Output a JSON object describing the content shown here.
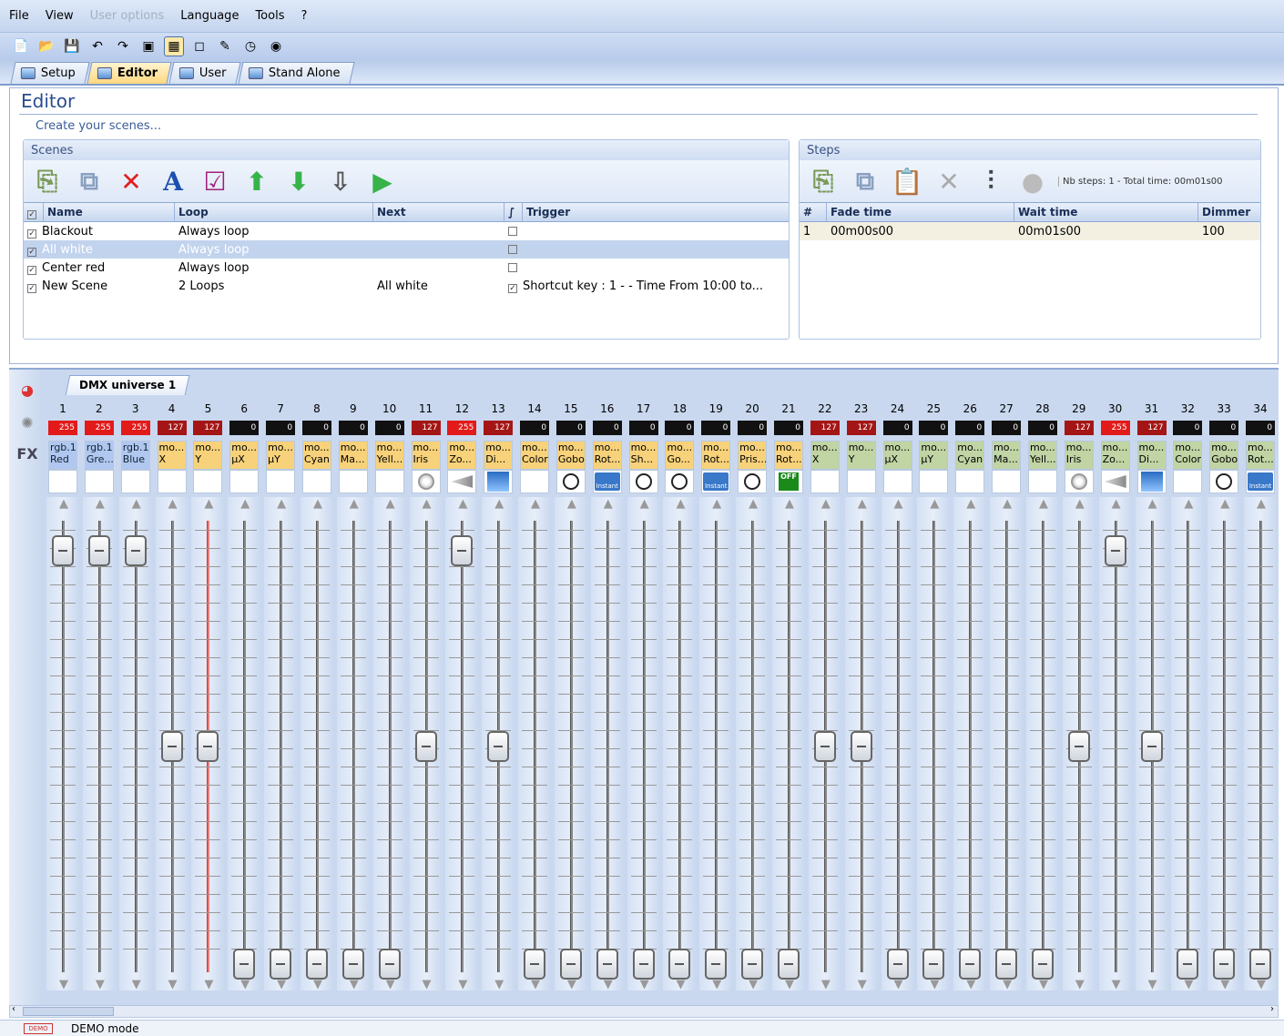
{
  "menu": {
    "file": "File",
    "view": "View",
    "user_options": "User options",
    "language": "Language",
    "tools": "Tools",
    "help": "?"
  },
  "tabs": [
    {
      "label": "Setup"
    },
    {
      "label": "Editor"
    },
    {
      "label": "User"
    },
    {
      "label": "Stand Alone"
    }
  ],
  "editor": {
    "title": "Editor",
    "subtitle": "Create your scenes..."
  },
  "scenes": {
    "header": "Scenes",
    "columns": [
      "Name",
      "Loop",
      "Next",
      "Trigger"
    ],
    "rows": [
      {
        "name": "Blackout",
        "loop": "Always loop",
        "next": "",
        "trigger": ""
      },
      {
        "name": "All white",
        "loop": "Always loop",
        "next": "",
        "trigger": ""
      },
      {
        "name": "Center red",
        "loop": "Always loop",
        "next": "",
        "trigger": ""
      },
      {
        "name": "New Scene",
        "loop": "2 Loops",
        "next": "All white",
        "trigger": "Shortcut key : 1 - - Time From 10:00  to..."
      }
    ]
  },
  "steps": {
    "header": "Steps",
    "summary": "Nb steps: 1 - Total time: 00m01s00",
    "columns": [
      "#",
      "Fade time",
      "Wait time",
      "Dimmer"
    ],
    "rows": [
      {
        "num": "1",
        "fade": "00m00s00",
        "wait": "00m01s00",
        "dimmer": "100"
      }
    ]
  },
  "universe": {
    "tab": "DMX universe 1"
  },
  "status": {
    "badge": "DEMO",
    "text": "DEMO mode"
  },
  "colors": {
    "accent": "#2a4d8f",
    "value_red": "#e31a1a",
    "value_dark": "#a41616",
    "channel_blue": "#b0c7f0",
    "channel_orange": "#f7d27a",
    "channel_green": "#c0d4a4"
  },
  "channels": [
    {
      "n": "1",
      "v": "255",
      "vc": "red",
      "label": "rgb.1\nRed",
      "c": "b",
      "icon": "",
      "lvl": 0.95
    },
    {
      "n": "2",
      "v": "255",
      "vc": "red",
      "label": "rgb.1\nGre...",
      "c": "b",
      "icon": "",
      "lvl": 0.95
    },
    {
      "n": "3",
      "v": "255",
      "vc": "red",
      "label": "rgb.1\nBlue",
      "c": "b",
      "icon": "",
      "lvl": 0.95
    },
    {
      "n": "4",
      "v": "127",
      "vc": "dred",
      "label": "mo...\nX",
      "c": "o",
      "icon": "",
      "lvl": 0.5
    },
    {
      "n": "5",
      "v": "127",
      "vc": "dred",
      "label": "mo...\nY",
      "c": "o",
      "icon": "",
      "lvl": 0.5,
      "redrail": true
    },
    {
      "n": "6",
      "v": "0",
      "vc": "blk",
      "label": "mo...\nµX",
      "c": "o",
      "icon": "",
      "lvl": 0
    },
    {
      "n": "7",
      "v": "0",
      "vc": "blk",
      "label": "mo...\nµY",
      "c": "o",
      "icon": "",
      "lvl": 0
    },
    {
      "n": "8",
      "v": "0",
      "vc": "blk",
      "label": "mo...\nCyan",
      "c": "o",
      "icon": "",
      "lvl": 0
    },
    {
      "n": "9",
      "v": "0",
      "vc": "blk",
      "label": "mo...\nMa...",
      "c": "o",
      "icon": "",
      "lvl": 0
    },
    {
      "n": "10",
      "v": "0",
      "vc": "blk",
      "label": "mo...\nYell...",
      "c": "o",
      "icon": "",
      "lvl": 0
    },
    {
      "n": "11",
      "v": "127",
      "vc": "dred",
      "label": "mo...\nIris",
      "c": "o",
      "icon": "iris",
      "lvl": 0.5
    },
    {
      "n": "12",
      "v": "255",
      "vc": "red",
      "label": "mo...\nZo...",
      "c": "o",
      "icon": "zoom",
      "lvl": 0.95
    },
    {
      "n": "13",
      "v": "127",
      "vc": "dred",
      "label": "mo...\nDi...",
      "c": "o",
      "icon": "dimm",
      "lvl": 0.5
    },
    {
      "n": "14",
      "v": "0",
      "vc": "blk",
      "label": "mo...\nColor",
      "c": "o",
      "icon": "",
      "lvl": 0
    },
    {
      "n": "15",
      "v": "0",
      "vc": "blk",
      "label": "mo...\nGobo",
      "c": "o",
      "icon": "gobo",
      "lvl": 0
    },
    {
      "n": "16",
      "v": "0",
      "vc": "blk",
      "label": "mo...\nRot...",
      "c": "o",
      "icon": "rot",
      "lvl": 0
    },
    {
      "n": "17",
      "v": "0",
      "vc": "blk",
      "label": "mo...\nSh...",
      "c": "o",
      "icon": "gobo",
      "lvl": 0
    },
    {
      "n": "18",
      "v": "0",
      "vc": "blk",
      "label": "mo...\nGo...",
      "c": "o",
      "icon": "gobo",
      "lvl": 0
    },
    {
      "n": "19",
      "v": "0",
      "vc": "blk",
      "label": "mo...\nRot...",
      "c": "o",
      "icon": "rot",
      "lvl": 0
    },
    {
      "n": "20",
      "v": "0",
      "vc": "blk",
      "label": "mo...\nPris...",
      "c": "o",
      "icon": "gobo",
      "lvl": 0
    },
    {
      "n": "21",
      "v": "0",
      "vc": "blk",
      "label": "mo...\nRot...",
      "c": "o",
      "icon": "off",
      "lvl": 0
    },
    {
      "n": "22",
      "v": "127",
      "vc": "dred",
      "label": "mo...\nX",
      "c": "g",
      "icon": "",
      "lvl": 0.5
    },
    {
      "n": "23",
      "v": "127",
      "vc": "dred",
      "label": "mo...\nY",
      "c": "g",
      "icon": "",
      "lvl": 0.5
    },
    {
      "n": "24",
      "v": "0",
      "vc": "blk",
      "label": "mo...\nµX",
      "c": "g",
      "icon": "",
      "lvl": 0
    },
    {
      "n": "25",
      "v": "0",
      "vc": "blk",
      "label": "mo...\nµY",
      "c": "g",
      "icon": "",
      "lvl": 0
    },
    {
      "n": "26",
      "v": "0",
      "vc": "blk",
      "label": "mo...\nCyan",
      "c": "g",
      "icon": "",
      "lvl": 0
    },
    {
      "n": "27",
      "v": "0",
      "vc": "blk",
      "label": "mo...\nMa...",
      "c": "g",
      "icon": "",
      "lvl": 0
    },
    {
      "n": "28",
      "v": "0",
      "vc": "blk",
      "label": "mo...\nYell...",
      "c": "g",
      "icon": "",
      "lvl": 0
    },
    {
      "n": "29",
      "v": "127",
      "vc": "dred",
      "label": "mo...\nIris",
      "c": "g",
      "icon": "iris",
      "lvl": 0.5
    },
    {
      "n": "30",
      "v": "255",
      "vc": "red",
      "label": "mo...\nZo...",
      "c": "g",
      "icon": "zoom",
      "lvl": 0.95
    },
    {
      "n": "31",
      "v": "127",
      "vc": "dred",
      "label": "mo...\nDi...",
      "c": "g",
      "icon": "dimm",
      "lvl": 0.5
    },
    {
      "n": "32",
      "v": "0",
      "vc": "blk",
      "label": "mo...\nColor",
      "c": "g",
      "icon": "",
      "lvl": 0
    },
    {
      "n": "33",
      "v": "0",
      "vc": "blk",
      "label": "mo...\nGobo",
      "c": "g",
      "icon": "gobo",
      "lvl": 0
    },
    {
      "n": "34",
      "v": "0",
      "vc": "blk",
      "label": "mo...\nRot...",
      "c": "g",
      "icon": "rot",
      "lvl": 0
    }
  ]
}
